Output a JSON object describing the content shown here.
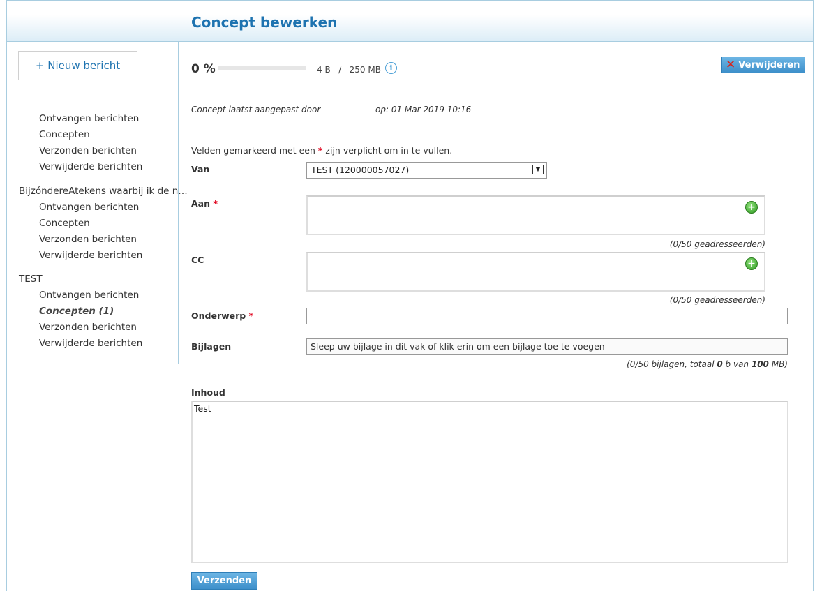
{
  "header": {
    "title": "Concept bewerken"
  },
  "sidebar": {
    "new_message": "+ Nieuw bericht",
    "default_items": [
      "Ontvangen berichten",
      "Concepten",
      "Verzonden berichten",
      "Verwijderde berichten"
    ],
    "groups": [
      {
        "name": "BijzóndereAtekens waarbij ik de n…",
        "items": [
          "Ontvangen berichten",
          "Concepten",
          "Verzonden berichten",
          "Verwijderde berichten"
        ]
      },
      {
        "name": "TEST",
        "items": [
          "Ontvangen berichten",
          "Concepten (1)",
          "Verzonden berichten",
          "Verwijderde berichten"
        ],
        "active_item": "Concepten (1)"
      }
    ]
  },
  "storage": {
    "percent": "0 %",
    "fill_fraction": 0,
    "used": "4 B",
    "separator": "/",
    "total": "250 MB"
  },
  "toolbar": {
    "delete_label": "Verwijderen",
    "send_label": "Verzenden"
  },
  "meta": {
    "modified_by": "Concept laatst aangepast door",
    "modified_on": "op: 01 Mar 2019 10:16"
  },
  "form": {
    "required_note_before": "Velden gemarkeerd met een ",
    "required_star": "*",
    "required_note_after": " zijn verplicht om in te vullen.",
    "from_label": "Van",
    "from_value": "TEST (120000057027)",
    "to_label": "Aan",
    "to_count": "(0/50 geadresseerden)",
    "cc_label": "CC",
    "cc_count": "(0/50 geadresseerden)",
    "subject_label": "Onderwerp",
    "subject_value": "",
    "attachments_label": "Bijlagen",
    "attachments_placeholder": "Sleep uw bijlage in dit vak of klik erin om een bijlage toe te voegen",
    "attachments_summary": {
      "before": "(0/50 bijlagen, totaal ",
      "count_size": "0",
      "middle": " b van ",
      "max": "100",
      "after": " MB)"
    },
    "body_label": "Inhoud",
    "body_value": "Test"
  },
  "colors": {
    "accent": "#1e73b0",
    "button": "#3d8fca",
    "required": "#e0001b"
  }
}
